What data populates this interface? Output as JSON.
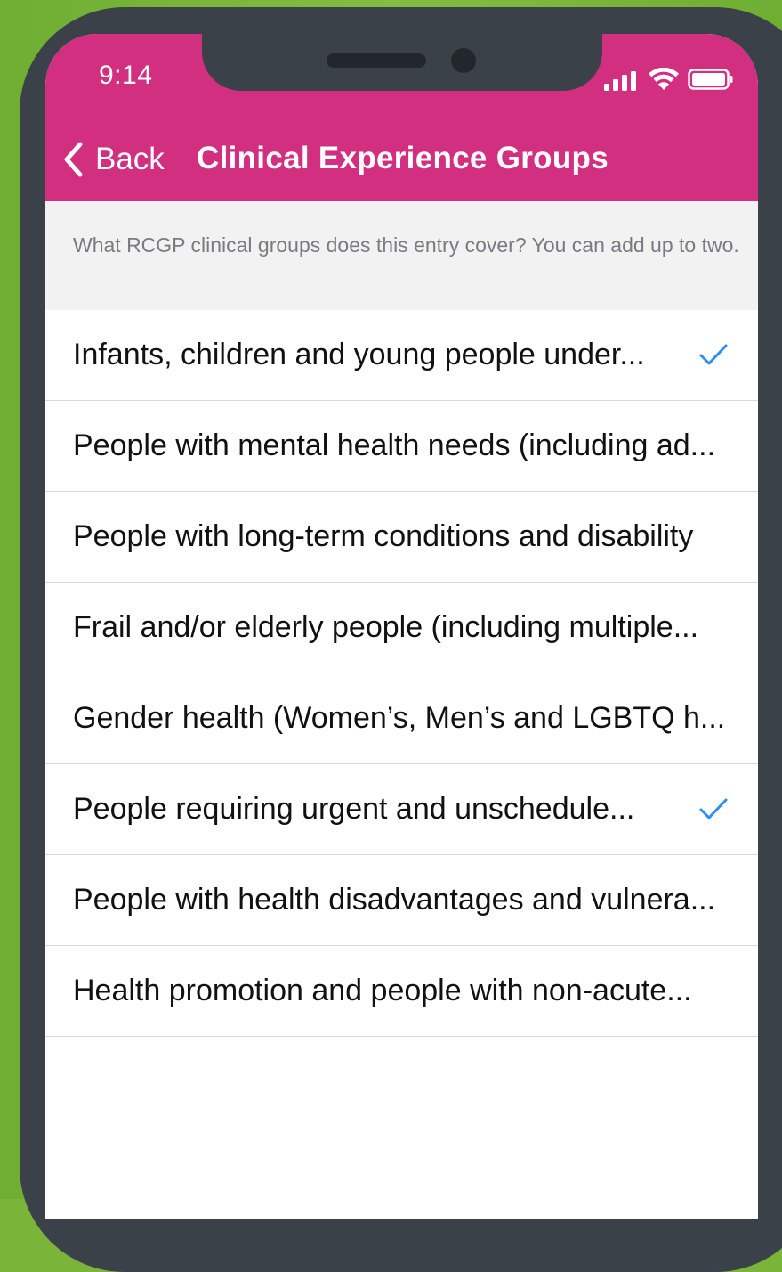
{
  "status_bar": {
    "time": "9:14"
  },
  "nav": {
    "back_label": "Back",
    "title": "Clinical Experience Groups"
  },
  "section": {
    "description": "What RCGP clinical groups does this entry cover? You can add up to two."
  },
  "items": [
    {
      "label": "Infants, children and young people under...",
      "selected": true
    },
    {
      "label": "People with mental health needs (including ad...",
      "selected": false
    },
    {
      "label": "People with long-term conditions and disability",
      "selected": false
    },
    {
      "label": "Frail and/or elderly people (including multiple...",
      "selected": false
    },
    {
      "label": "Gender health (Women’s, Men’s and LGBTQ h...",
      "selected": false
    },
    {
      "label": "People requiring urgent and unschedule...",
      "selected": true
    },
    {
      "label": "People with health disadvantages and vulnera...",
      "selected": false
    },
    {
      "label": "Health promotion and people with non-acute...",
      "selected": false
    }
  ],
  "colors": {
    "header": "#d32f80",
    "accent_check": "#2e8ff0",
    "background": "#7ab53a",
    "device_frame": "#3b4149"
  },
  "icons": {
    "back": "chevron-left-icon",
    "check": "checkmark-icon",
    "signal": "cellular-signal-icon",
    "wifi": "wifi-icon",
    "battery": "battery-icon"
  }
}
